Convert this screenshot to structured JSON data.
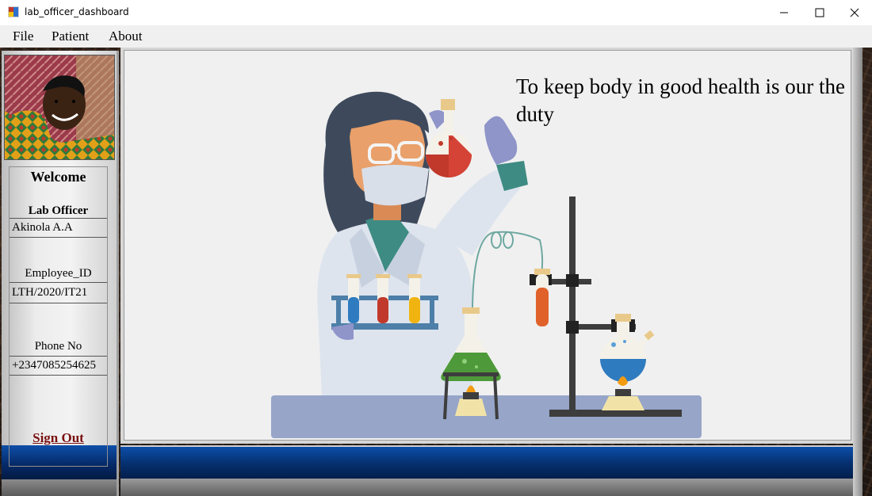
{
  "window": {
    "title": "lab_officer_dashboard",
    "controls": {
      "minimize_icon": "minimize-icon",
      "maximize_icon": "maximize-icon",
      "close_icon": "close-icon"
    }
  },
  "menu": {
    "items": [
      "File",
      "Patient",
      "About"
    ]
  },
  "sidebar": {
    "welcome": "Welcome",
    "role": "Lab Officer",
    "name": "Akinola A.A",
    "employee_id_label": "Employee_ID",
    "employee_id": "LTH/2020/IT21",
    "phone_label": "Phone No",
    "phone": "+2347085254625",
    "sign_out": "Sign Out"
  },
  "main": {
    "slogan": "To keep body in good health is our the duty",
    "illustration": "lab-scientist-illustration"
  },
  "colors": {
    "sign_out": "#7a1010",
    "blue_bar": "#0c4eaa",
    "panel": "#f0f0f0"
  }
}
